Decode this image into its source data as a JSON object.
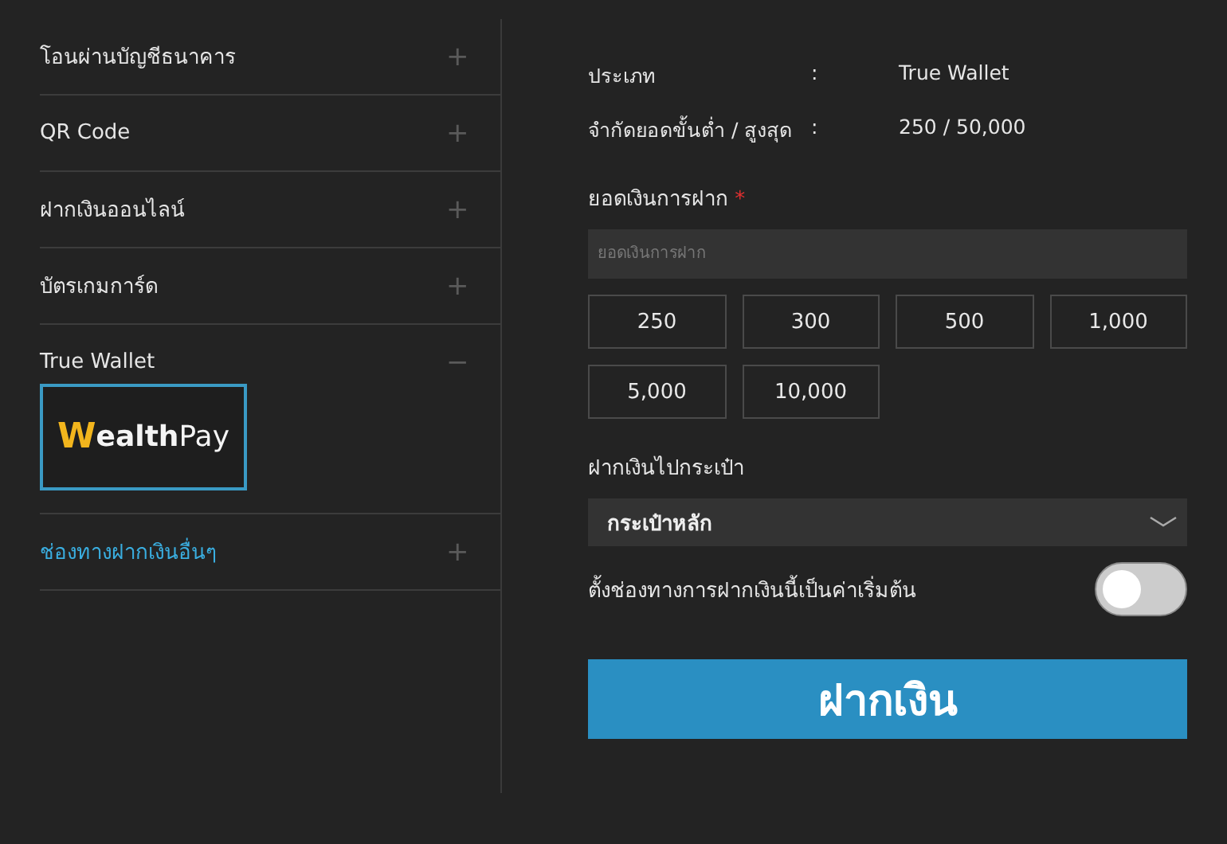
{
  "methods": [
    {
      "label": "โอนผ่านบัญชีธนาคาร",
      "expanded": false,
      "highlighted": false
    },
    {
      "label": "QR Code",
      "expanded": false,
      "highlighted": false
    },
    {
      "label": "ฝากเงินออนไลน์",
      "expanded": false,
      "highlighted": false
    },
    {
      "label": "บัตรเกมการ์ด",
      "expanded": false,
      "highlighted": false
    },
    {
      "label": "True Wallet",
      "expanded": true,
      "highlighted": false,
      "providers": [
        {
          "logo": [
            "W",
            "ealth",
            "Pay"
          ],
          "selected": true
        }
      ]
    },
    {
      "label": "ช่องทางฝากเงินอื่นๆ",
      "expanded": false,
      "highlighted": true
    }
  ],
  "icons": {
    "collapsed": "+",
    "expanded": "−"
  },
  "info": [
    {
      "label": "ประเภท",
      "separator": ":",
      "value": "True Wallet"
    },
    {
      "label": "จำกัดยอดขั้นต่ำ / สูงสุด",
      "separator": ":",
      "value": "250 / 50,000"
    }
  ],
  "amount": {
    "label": "ยอดเงินการฝาก",
    "required_mark": "*",
    "placeholder": "ยอดเงินการฝาก"
  },
  "presets": [
    "250",
    "300",
    "500",
    "1,000",
    "5,000",
    "10,000"
  ],
  "wallet": {
    "label": "ฝากเงินไปกระเป๋า",
    "value": "กระเป๋าหลัก"
  },
  "default_toggle": {
    "label": "ตั้งช่องทางการฝากเงินนี้เป็นค่าเริ่มต้น",
    "on": false
  },
  "submit": "ฝากเงิน"
}
